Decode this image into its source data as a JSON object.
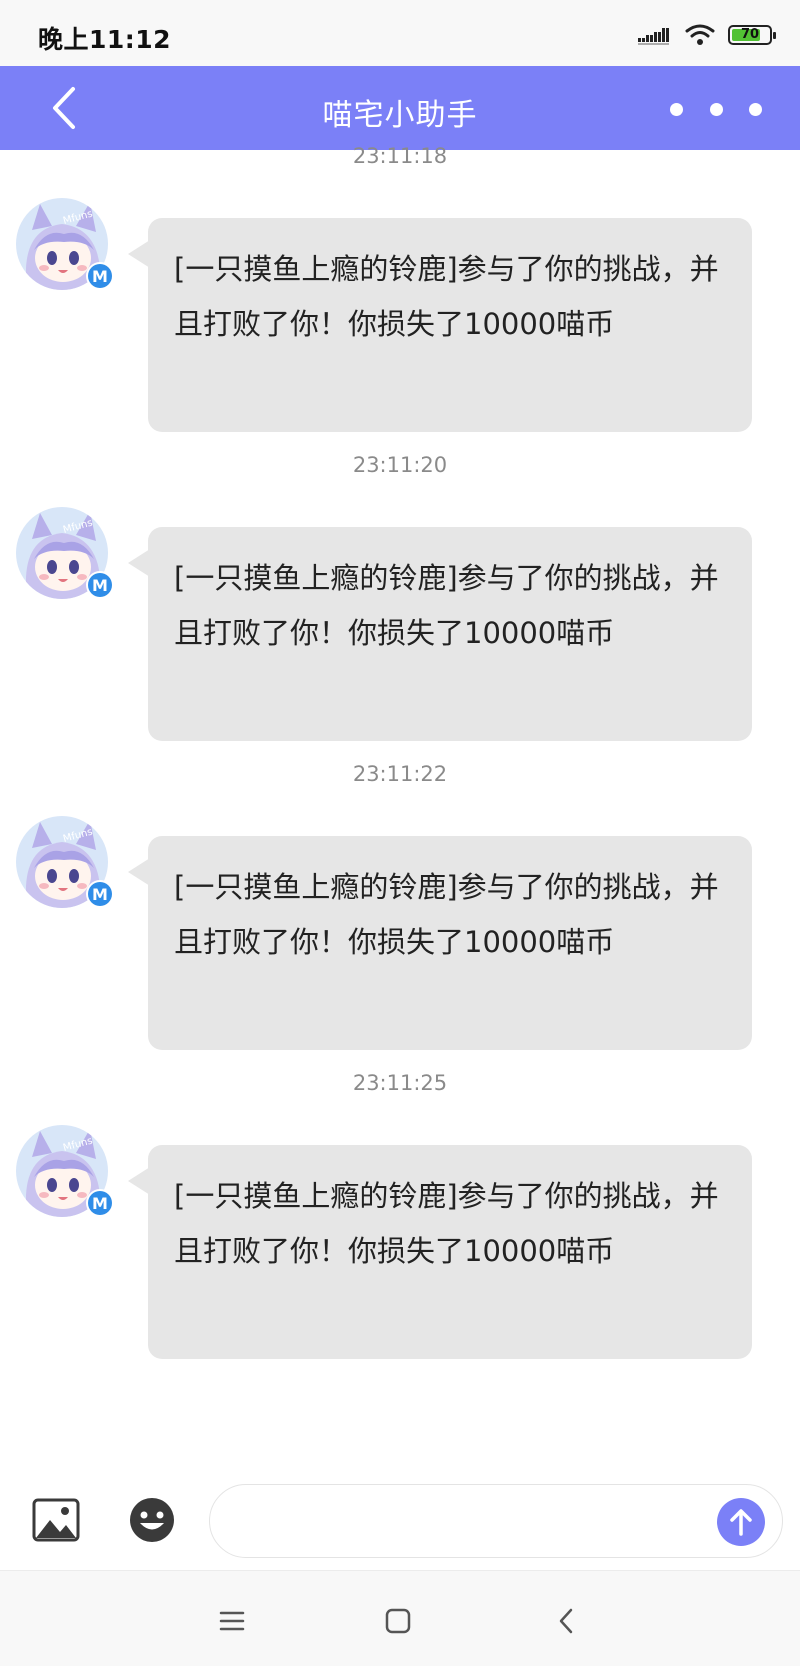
{
  "status_bar": {
    "time": "晚上11:12",
    "battery_level": "70",
    "icons": [
      "signal-icon",
      "wifi-icon",
      "battery-icon"
    ],
    "battery_color": "#52c234"
  },
  "header": {
    "title": "喵宅小助手",
    "back_icon": "chevron-left-icon",
    "more_icon": "more-dots-icon",
    "background_color": "#7b80f7"
  },
  "messages": [
    {
      "time": "23:11:18",
      "text": "[一只摸鱼上瘾的铃鹿]参与了你的挑战，并且打败了你！你损失了10000喵币"
    },
    {
      "time": "23:11:20",
      "text": "[一只摸鱼上瘾的铃鹿]参与了你的挑战，并且打败了你！你损失了10000喵币"
    },
    {
      "time": "23:11:22",
      "text": "[一只摸鱼上瘾的铃鹿]参与了你的挑战，并且打败了你！你损失了10000喵币"
    },
    {
      "time": "23:11:25",
      "text": "[一只摸鱼上瘾的铃鹿]参与了你的挑战，并且打败了你！你损失了10000喵币"
    }
  ],
  "avatar": {
    "watermark": "Mfuns",
    "badge": "M",
    "badge_color": "#2f8de8"
  },
  "input_bar": {
    "placeholder": "",
    "value": "",
    "image_icon": "image-icon",
    "emoji_icon": "emoji-icon",
    "send_icon": "send-arrow-icon"
  },
  "nav_bar": {
    "buttons": [
      "menu-icon",
      "home-icon",
      "back-icon"
    ]
  }
}
